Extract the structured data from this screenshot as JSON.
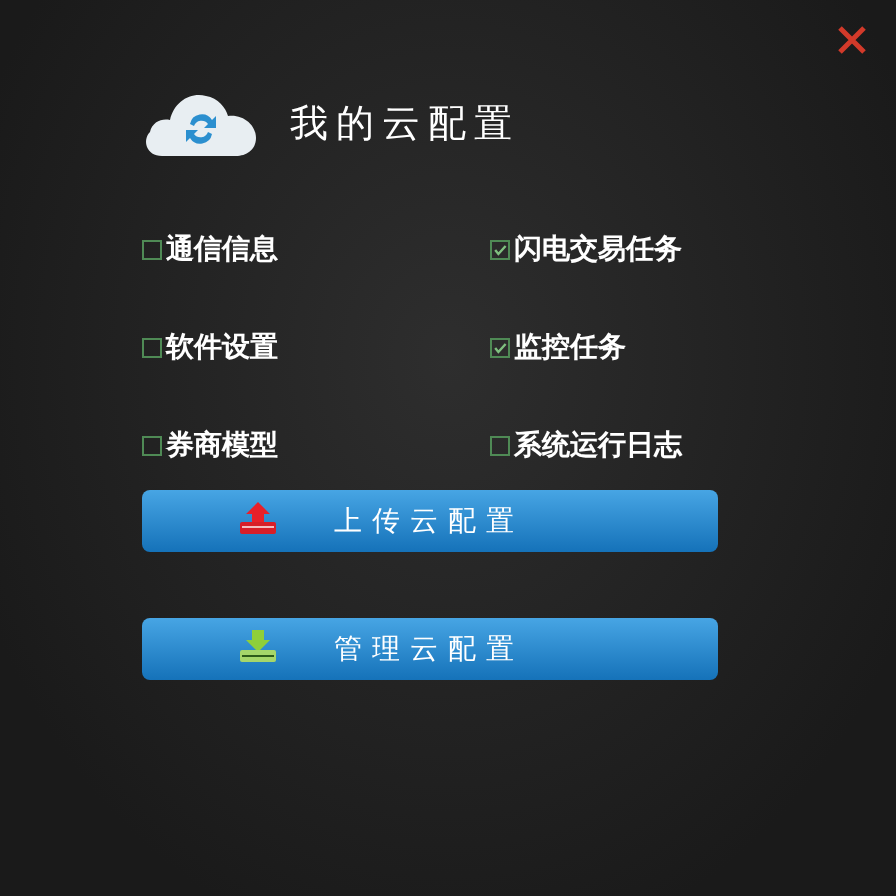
{
  "title": "我的云配置",
  "options": [
    {
      "label": "通信信息",
      "checked": false
    },
    {
      "label": "闪电交易任务",
      "checked": true
    },
    {
      "label": "软件设置",
      "checked": false
    },
    {
      "label": "监控任务",
      "checked": true
    },
    {
      "label": "券商模型",
      "checked": false
    },
    {
      "label": "系统运行日志",
      "checked": false
    }
  ],
  "buttons": [
    {
      "label": "上传云配置",
      "kind": "upload"
    },
    {
      "label": "管理云配置",
      "kind": "manage"
    }
  ]
}
